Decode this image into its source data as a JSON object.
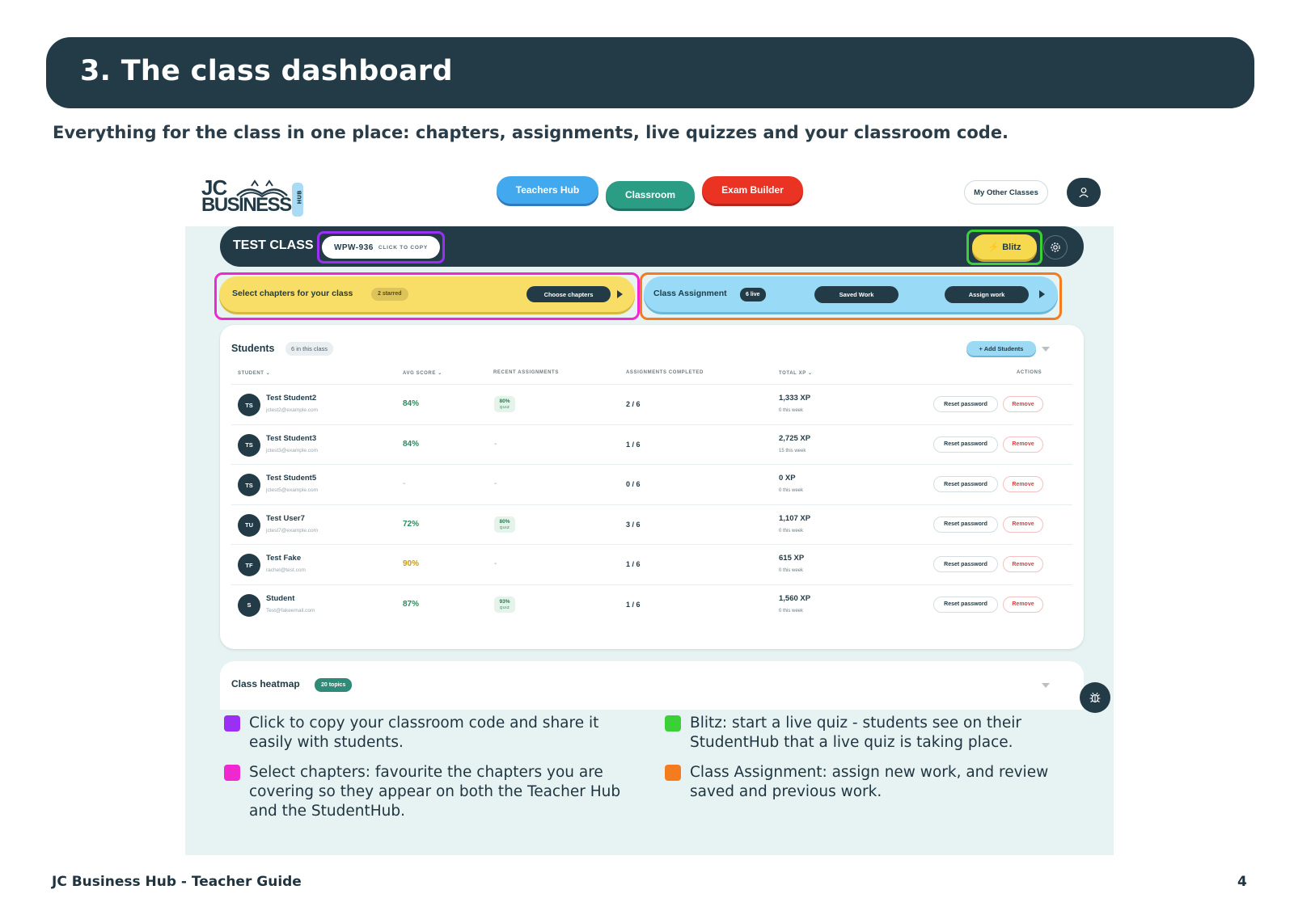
{
  "page": {
    "title": "3. The class dashboard",
    "subtitle": "Everything for the class in one place: chapters, assignments, live quizzes and your classroom code.",
    "footer_left": "JC Business Hub - Teacher Guide",
    "page_number": "4"
  },
  "app": {
    "logo": {
      "line1": "JC",
      "line2": "BUSINESS",
      "tag": "HUB"
    },
    "nav": {
      "teachers_hub": "Teachers Hub",
      "classroom": "Classroom",
      "exam_builder": "Exam Builder"
    },
    "my_other_classes": "My Other Classes",
    "class_bar": {
      "class_name": "TEST CLASS",
      "code": "WPW-936",
      "copy_hint": "CLICK TO COPY",
      "blitz": "Blitz"
    },
    "chapters": {
      "label": "Select chapters for your class",
      "starred": "2 starred",
      "button": "Choose chapters"
    },
    "assignment": {
      "label": "Class Assignment",
      "live": "6 live",
      "saved_work": "Saved Work",
      "assign_work": "Assign work"
    },
    "students": {
      "title": "Students",
      "count": "6 in this class",
      "add_button": "+ Add Students",
      "columns": {
        "student": "STUDENT ⌄",
        "avg": "AVG SCORE ⌄",
        "recent": "RECENT ASSIGNMENTS",
        "completed": "ASSIGNMENTS COMPLETED",
        "xp": "TOTAL XP ⌄",
        "actions": "ACTIONS"
      },
      "rows": [
        {
          "initials": "TS",
          "name": "Test Student2",
          "email": "jctest2@example.com",
          "avg": "84%",
          "recent": "80%",
          "completed": "2 / 6",
          "xp": "1,333 XP",
          "week": "0 this week"
        },
        {
          "initials": "TS",
          "name": "Test Student3",
          "email": "jctest3@example.com",
          "avg": "84%",
          "recent": "-",
          "completed": "1 / 6",
          "xp": "2,725 XP",
          "week": "15 this week"
        },
        {
          "initials": "TS",
          "name": "Test Student5",
          "email": "jctest5@example.com",
          "avg": "-",
          "recent": "-",
          "completed": "0 / 6",
          "xp": "0 XP",
          "week": "0 this week"
        },
        {
          "initials": "TU",
          "name": "Test User7",
          "email": "jctest7@example.com",
          "avg": "72%",
          "recent": "80%",
          "completed": "3 / 6",
          "xp": "1,107 XP",
          "week": "0 this week"
        },
        {
          "initials": "TF",
          "name": "Test Fake",
          "email": "rachel@test.com",
          "avg": "90%",
          "recent": "-",
          "completed": "1 / 6",
          "xp": "615 XP",
          "week": "0 this week"
        },
        {
          "initials": "S",
          "name": "Student",
          "email": "Test@fakeemail.com",
          "avg": "87%",
          "recent": "93%",
          "completed": "1 / 6",
          "xp": "1,560 XP",
          "week": "0 this week"
        }
      ],
      "quiz_label": "QUIZ",
      "reset_label": "Reset password",
      "remove_label": "Remove"
    },
    "heatmap": {
      "title": "Class heatmap",
      "topics": "20 topics"
    }
  },
  "legend": [
    {
      "color": "#9b2ff3",
      "text": "Click to copy your classroom code and share it easily with students."
    },
    {
      "color": "#f028cf",
      "text": "Select chapters: favourite the chapters you are covering so they appear on both the Teacher Hub and the StudentHub."
    },
    {
      "color": "#3ad137",
      "text": "Blitz: start a live quiz - students see on their StudentHub that a live quiz is taking place."
    },
    {
      "color": "#f47c1f",
      "text": "Class Assignment: assign new work, and review saved and previous work."
    }
  ],
  "colors": {
    "green_score": "#2a8a5c",
    "amber_score": "#c79a1a",
    "muted": "#9aa5ab"
  }
}
